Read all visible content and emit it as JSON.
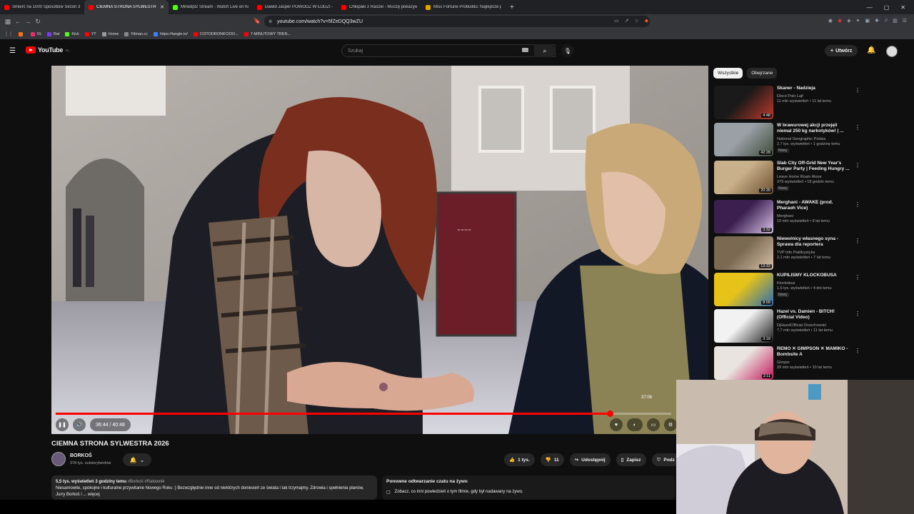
{
  "browser": {
    "tabs": [
      {
        "title": "Śmierć na 1000 Sposobów Sezon 3 (",
        "color": "#ff0000",
        "active": false
      },
      {
        "title": "CIEMNA STRONA SYLWESTR",
        "color": "#ff0000",
        "active": true
      },
      {
        "title": "Minedpl2 Stream - Watch Live on Ki",
        "color": "#53fc18",
        "active": false
      },
      {
        "title": "Dawid Jasper POWÓDŹ W ŁODZI -",
        "color": "#ff0000",
        "active": false
      },
      {
        "title": "Chłopaki z Raszei - Muszę pokazywa",
        "color": "#ff0000",
        "active": false
      },
      {
        "title": "Miss Fortune Probuildu: Najlepsze p",
        "color": "#e0a800",
        "active": false
      }
    ],
    "new_tab": "+",
    "url": "youtube.com/watch?v=5fZeDQQ3wZU",
    "bookmarks": [
      {
        "label": "",
        "color": "#f97316"
      },
      {
        "label": "IG",
        "color": "#e1306c"
      },
      {
        "label": "Rat",
        "color": "#7c3aed"
      },
      {
        "label": "Kick",
        "color": "#53fc18"
      },
      {
        "label": "YT",
        "color": "#ff0000"
      },
      {
        "label": "Home",
        "color": "#999999"
      },
      {
        "label": "Filman.cc",
        "color": "#888888"
      },
      {
        "label": "https://tangle.io/",
        "color": "#3b82f6"
      },
      {
        "label": "CI3TODRON¢CIOO...",
        "color": "#ff0000"
      },
      {
        "label": "7-MINUTOWY TREN...",
        "color": "#ff0000"
      }
    ]
  },
  "youtube": {
    "logo_text": "YouTube",
    "logo_region": "PL",
    "search_placeholder": "Szukaj",
    "create_label": "Utwórz",
    "accent": "#ff0000"
  },
  "player": {
    "time_current": "36:44",
    "time_total": "40:48",
    "time_display": "36:44 / 40:48",
    "hover_time": "37:08",
    "progress_fraction": 0.9
  },
  "video": {
    "title": "CIEMNA STRONA SYLWESTRA 2026",
    "channel": "BORKOŚ",
    "subscribers": "378 tys. subskrybentów",
    "likes": "1 tys.",
    "dislikes": "11",
    "share_label": "Udostępnij",
    "save_label": "Zapisz",
    "thanks_label": "Podz",
    "desc_meta": "5,5 tys. wyświetleń  3 godziny temu",
    "desc_tags": "#Borkoś #Ratownik",
    "desc_text": "Niesamowite, spokojne i kulturalne przywitanie Nowego Roku :) Bezwzględnie inne od niektórych doniesień ze świata i tak trzymajmy. Zdrowia i spełnienia planów, Jurry Borkoś i ... więcej",
    "replay_title": "Ponowne odtwarzanie czatu na żywo",
    "replay_sub": "Zobacz, co inni powiedzieli o tym filmie, gdy był nadawany na żywo."
  },
  "sidebar": {
    "chips": [
      "Wszystkie",
      "Obejrzane"
    ],
    "items": [
      {
        "title": "Skaner - Nadzieja",
        "channel": "Disco Polo Lajf",
        "meta": "11 mln wyświetleń • 11 lat temu",
        "duration": "4:48",
        "new": "",
        "c1": "#1a1a1a",
        "c2": "#c0392b"
      },
      {
        "title": "W brawurowej akcji przejęli niemal 250 kg narkotyków! | ...",
        "channel": "National Geographic Polska",
        "meta": "2,7 tys. wyświetleń • 1 godzinę temu",
        "duration": "42:28",
        "new": "Nowy",
        "c1": "#9aa0a6",
        "c2": "#3d4a3a"
      },
      {
        "title": "Slab City Off-Grid New Year's Burger Party | Feeding Hungry ...",
        "channel": "Leave Home Roam Alone",
        "meta": "379 wyświetleń • 18 godzin temu",
        "duration": "20:35",
        "new": "Nowy",
        "c1": "#c8b08a",
        "c2": "#6b4e2e"
      },
      {
        "title": "Merghani - AWAKE (prod. Pharaoh Vice)",
        "channel": "Merghani",
        "meta": "10 mln wyświetleń • 8 lat temu",
        "duration": "3:32",
        "new": "",
        "c1": "#3a1f4f",
        "c2": "#d9c3e8"
      },
      {
        "title": "Niewolnicy własnego syna - Sprawa dla reportera",
        "channel": "TVP Info Publicystyka",
        "meta": "2,1 mln wyświetleń • 7 lat temu",
        "duration": "13:32",
        "new": "",
        "c1": "#7a6a52",
        "c2": "#d8c0a8"
      },
      {
        "title": "KUPILIŚMY KLOCKOBUSA",
        "channel": "Klockobus",
        "meta": "1,6 tys. wyświetleń • 4 dni temu",
        "duration": "8:09",
        "new": "Nowy",
        "c1": "#e6c319",
        "c2": "#2b6cb0"
      },
      {
        "title": "Hazel vs. Damien - BITCH! (Official Video)",
        "channel": "DjHazelOfficial Orzechowski",
        "meta": "7,7 mln wyświetleń • 11 lat temu",
        "duration": "3:18",
        "new": "",
        "c1": "#f2f2f2",
        "c2": "#1a1a1a"
      },
      {
        "title": "REMO ✕ GIMPSON ✕ MAMIKO - Bombsite A",
        "channel": "Gimper",
        "meta": "29 mln wyświetleń • 10 lat temu",
        "duration": "2:11",
        "new": "",
        "c1": "#e9e4df",
        "c2": "#c2185b"
      }
    ]
  }
}
